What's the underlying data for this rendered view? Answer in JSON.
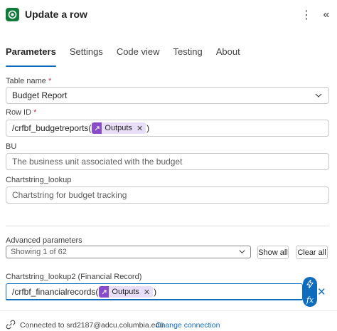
{
  "header": {
    "title": "Update a row",
    "app_icon": "dataverse-icon",
    "more_icon": "⋮",
    "collapse_icon": "«"
  },
  "tabs": [
    {
      "label": "Parameters",
      "active": true
    },
    {
      "label": "Settings",
      "active": false
    },
    {
      "label": "Code view",
      "active": false
    },
    {
      "label": "Testing",
      "active": false
    },
    {
      "label": "About",
      "active": false
    }
  ],
  "fields": {
    "table_name": {
      "label": "Table name",
      "required": "*",
      "value": "Budget Report"
    },
    "row_id": {
      "label": "Row ID",
      "required": "*",
      "prefix": "/crfbf_budgetreports(",
      "token": "Outputs",
      "suffix": ")"
    },
    "bu": {
      "label": "BU",
      "placeholder": "The business unit associated with the budget"
    },
    "chartstring_lookup": {
      "label": "Chartstring_lookup",
      "placeholder": "Chartstring for budget tracking"
    }
  },
  "advanced": {
    "label": "Advanced parameters",
    "showing": "Showing 1 of 62",
    "show_all": "Show all",
    "clear_all": "Clear all"
  },
  "lookup2": {
    "label": "Chartstring_lookup2 (Financial Record)",
    "prefix": "/crfbf_financialrecords(",
    "token": "Outputs",
    "suffix": ")"
  },
  "footer": {
    "connected_text": "Connected to srd2187@adcu.columbia.edu.",
    "change_link": "Change connection"
  },
  "colors": {
    "accent": "#0f6cbd",
    "brand": "#0f7b3b",
    "token_bg": "#e8def8",
    "token_icon": "#8a4bc9"
  }
}
